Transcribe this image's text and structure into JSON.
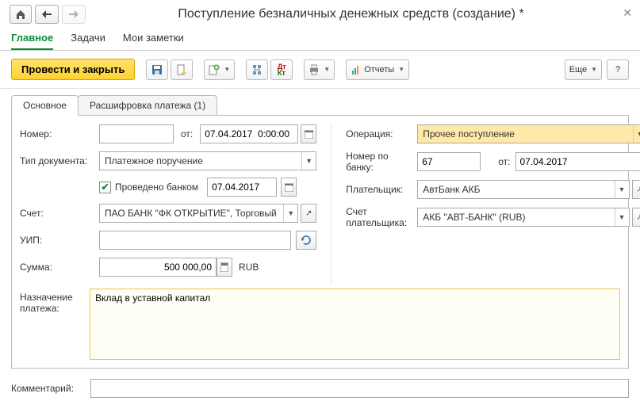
{
  "window": {
    "title": "Поступление безналичных денежных средств (создание) *"
  },
  "top_tabs": {
    "main": "Главное",
    "tasks": "Задачи",
    "notes": "Мои заметки"
  },
  "toolbar": {
    "main_action": "Провести и закрыть",
    "reports": "Отчеты",
    "more": "Еще",
    "help": "?"
  },
  "inner_tabs": {
    "main": "Основное",
    "details": "Расшифровка платежа (1)"
  },
  "left": {
    "number_label": "Номер:",
    "number_value": "",
    "from_label": "от:",
    "date_value": "07.04.2017  0:00:00",
    "doctype_label": "Тип документа:",
    "doctype_value": "Платежное поручение",
    "bankproc_label": "Проведено банком",
    "bankproc_date": "07.04.2017",
    "account_label": "Счет:",
    "account_value": "ПАО БАНК \"ФК ОТКРЫТИЕ\", Торговый",
    "uip_label": "УИП:",
    "uip_value": "",
    "sum_label": "Сумма:",
    "sum_value": "500 000,00",
    "currency": "RUB"
  },
  "right": {
    "operation_label": "Операция:",
    "operation_value": "Прочее поступление",
    "banknum_label": "Номер по банку:",
    "banknum_value": "67",
    "from_label": "от:",
    "bank_date": "07.04.2017",
    "payer_label": "Плательщик:",
    "payer_value": "АвтБанк АКБ",
    "payer_account_label": "Счет плательщика:",
    "payer_account_value": "АКБ \"АВТ-БАНК\" (RUB)"
  },
  "purpose": {
    "label": "Назначение платежа:",
    "value": "Вклад в уставной капитал"
  },
  "comment": {
    "label": "Комментарий:",
    "value": ""
  }
}
